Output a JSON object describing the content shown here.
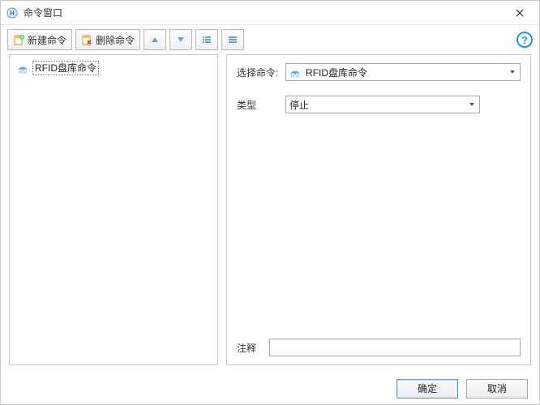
{
  "window": {
    "title": "命令窗口"
  },
  "toolbar": {
    "new_label": "新建命令",
    "delete_label": "删除命令"
  },
  "tree": {
    "items": [
      {
        "label": "RFID盘库命令"
      }
    ]
  },
  "form": {
    "select_label": "选择命令:",
    "select_value": "RFID盘库命令",
    "type_label": "类型",
    "type_value": "停止",
    "notes_label": "注释",
    "notes_value": ""
  },
  "footer": {
    "ok": "确定",
    "cancel": "取消"
  }
}
